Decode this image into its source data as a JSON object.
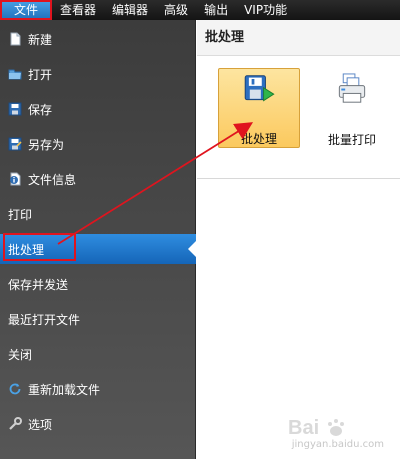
{
  "menubar": {
    "items": [
      {
        "label": "文件",
        "active": true
      },
      {
        "label": "查看器",
        "active": false
      },
      {
        "label": "编辑器",
        "active": false
      },
      {
        "label": "高级",
        "active": false
      },
      {
        "label": "输出",
        "active": false
      },
      {
        "label": "VIP功能",
        "active": false
      }
    ]
  },
  "sidebar": {
    "items": [
      {
        "label": "新建",
        "icon": "new-file-icon"
      },
      {
        "label": "打开",
        "icon": "open-folder-icon"
      },
      {
        "label": "保存",
        "icon": "save-icon"
      },
      {
        "label": "另存为",
        "icon": "save-as-icon"
      },
      {
        "label": "文件信息",
        "icon": "file-info-icon"
      },
      {
        "label": "打印",
        "icon": ""
      },
      {
        "label": "批处理",
        "icon": "",
        "selected": true
      },
      {
        "label": "保存并发送",
        "icon": ""
      },
      {
        "label": "最近打开文件",
        "icon": ""
      },
      {
        "label": "关闭",
        "icon": ""
      },
      {
        "label": "重新加载文件",
        "icon": "reload-icon"
      },
      {
        "label": "选项",
        "icon": "options-icon"
      }
    ]
  },
  "content": {
    "title": "批处理",
    "tiles": [
      {
        "label": "批处理",
        "icon": "batch-process-icon",
        "active": true
      },
      {
        "label": "批量打印",
        "icon": "batch-print-icon",
        "active": false
      }
    ]
  },
  "watermark": {
    "text": "jingyan.baidu.com"
  },
  "colors": {
    "menubar_bg": "#141414",
    "selected_blue": "#1f6fba",
    "tile_highlight": "#fbc95e",
    "annotation_red": "#e0141e"
  }
}
